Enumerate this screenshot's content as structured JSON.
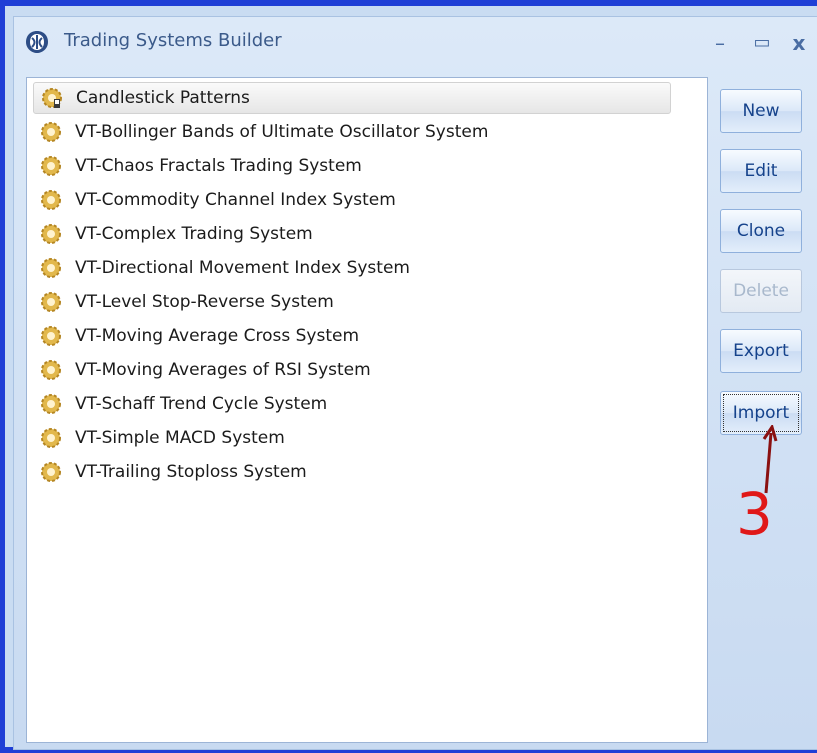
{
  "window": {
    "title": "Trading Systems Builder",
    "minimize_label": "–",
    "maximize_label": "▭",
    "close_label": "x"
  },
  "systems": [
    {
      "label": "Candlestick Patterns",
      "selected": true,
      "icon": "candlestick-gear-icon"
    },
    {
      "label": "VT-Bollinger Bands of Ultimate Oscillator System",
      "icon": "gear-icon"
    },
    {
      "label": "VT-Chaos Fractals Trading System",
      "icon": "gear-icon"
    },
    {
      "label": "VT-Commodity Channel Index System",
      "icon": "gear-icon"
    },
    {
      "label": "VT-Complex Trading System",
      "icon": "gear-icon"
    },
    {
      "label": "VT-Directional Movement Index System",
      "icon": "gear-icon"
    },
    {
      "label": "VT-Level Stop-Reverse System",
      "icon": "gear-icon"
    },
    {
      "label": "VT-Moving Average Cross System",
      "icon": "gear-icon"
    },
    {
      "label": "VT-Moving Averages of RSI System",
      "icon": "gear-icon"
    },
    {
      "label": "VT-Schaff Trend Cycle System",
      "icon": "gear-icon"
    },
    {
      "label": "VT-Simple MACD System",
      "icon": "gear-icon"
    },
    {
      "label": "VT-Trailing Stoploss System",
      "icon": "gear-icon"
    }
  ],
  "buttons": {
    "new": "New",
    "edit": "Edit",
    "clone": "Clone",
    "delete": "Delete",
    "export": "Export",
    "import": "Import"
  },
  "annotation": {
    "number": "3",
    "color": "#e01818"
  },
  "colors": {
    "frame_border": "#1f3fd6",
    "title_text": "#3b5a8a",
    "button_text": "#15428b"
  }
}
